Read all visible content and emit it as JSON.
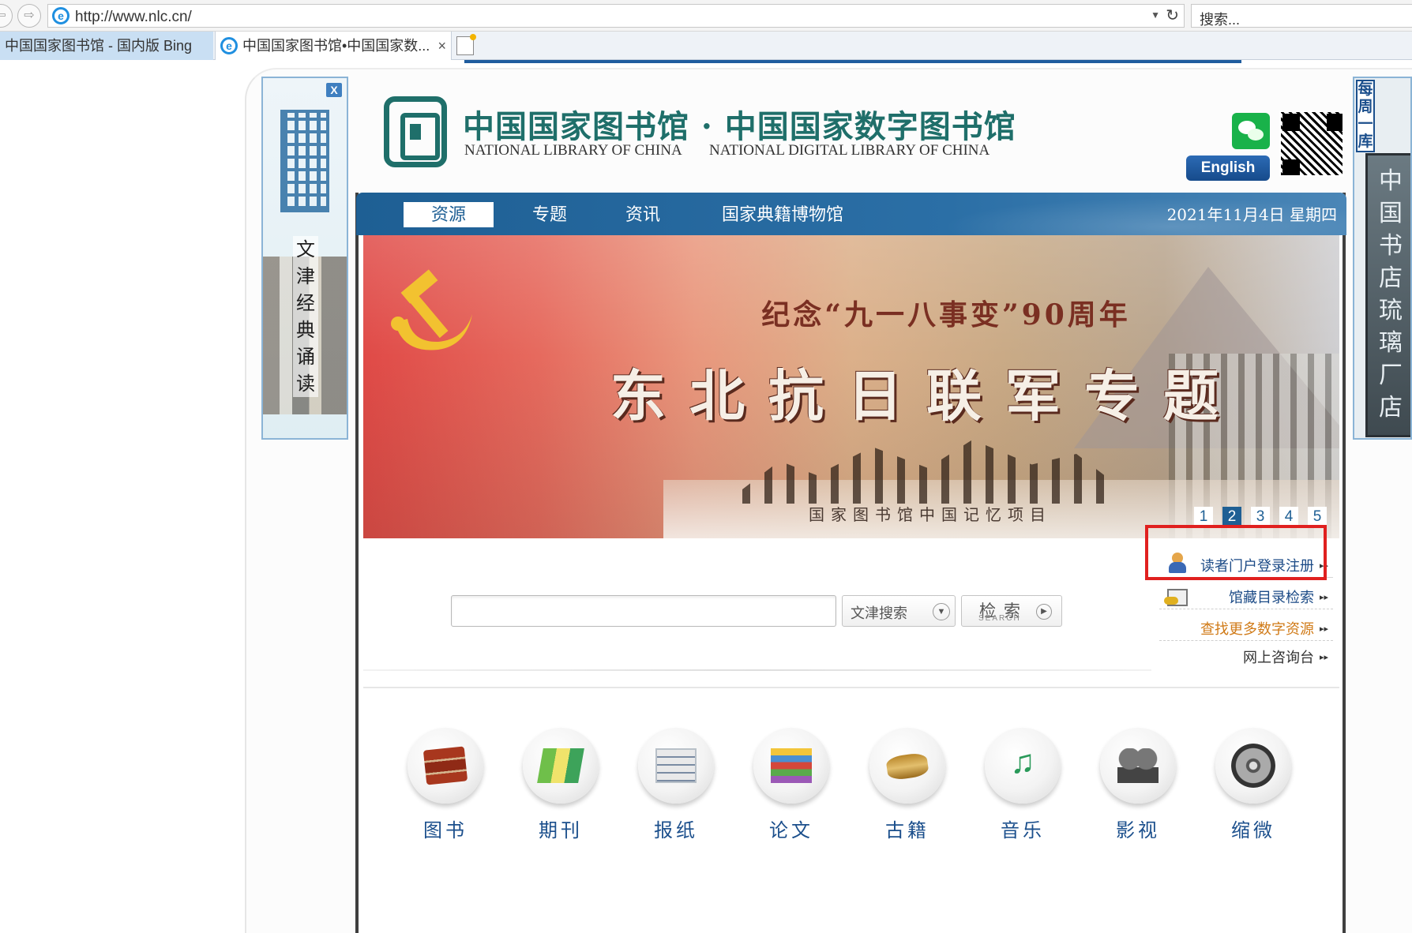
{
  "browser": {
    "url": "http://www.nlc.cn/",
    "search_placeholder": "搜索...",
    "tabs": [
      {
        "label": "中国国家图书馆 - 国内版 Bing"
      },
      {
        "label": "中国国家图书馆•中国国家数..."
      }
    ],
    "tab_close": "×"
  },
  "ad_left": {
    "text": "文津经典诵读",
    "close_label": "X"
  },
  "ad_right": {
    "header": "每周一库",
    "text": "中国书店琉璃厂店"
  },
  "header": {
    "title": "中国国家图书馆 · 中国国家数字图书馆",
    "subtitle_left": "NATIONAL LIBRARY OF CHINA",
    "subtitle_right": "NATIONAL DIGITAL LIBRARY OF CHINA",
    "english_label": "English"
  },
  "nav": {
    "items": [
      {
        "label": "资源"
      },
      {
        "label": "专题"
      },
      {
        "label": "资讯"
      },
      {
        "label": "国家典籍博物馆"
      }
    ],
    "date": "2021年11月4日  星期四"
  },
  "banner": {
    "line1": "纪念“九一八事变”90周年",
    "title": "东北抗日联军专题",
    "footer": "国家图书馆中国记忆项目",
    "pages": [
      "1",
      "2",
      "3",
      "4",
      "5"
    ],
    "active_page": "2"
  },
  "search": {
    "value": "",
    "scope_label": "文津搜索",
    "button_label": "检索",
    "button_sub": "SEARCH"
  },
  "quick_links": {
    "login": "读者门户登录注册",
    "catalog": "馆藏目录检索",
    "digital": "查找更多数字资源",
    "consult": "网上咨询台",
    "arrow": "▸▸"
  },
  "categories": [
    {
      "label": "图书",
      "icon": "book-icon"
    },
    {
      "label": "期刊",
      "icon": "journal-icon"
    },
    {
      "label": "报纸",
      "icon": "newspaper-icon"
    },
    {
      "label": "论文",
      "icon": "thesis-icon"
    },
    {
      "label": "古籍",
      "icon": "ancient-book-icon"
    },
    {
      "label": "音乐",
      "icon": "music-icon"
    },
    {
      "label": "影视",
      "icon": "film-icon"
    },
    {
      "label": "缩微",
      "icon": "microfilm-icon"
    }
  ],
  "colors": {
    "brand_green": "#1f6f6a",
    "nav_blue": "#1e5f94",
    "highlight_red": "#e0201f",
    "link_blue": "#1b4a86",
    "link_orange": "#d07a17"
  }
}
